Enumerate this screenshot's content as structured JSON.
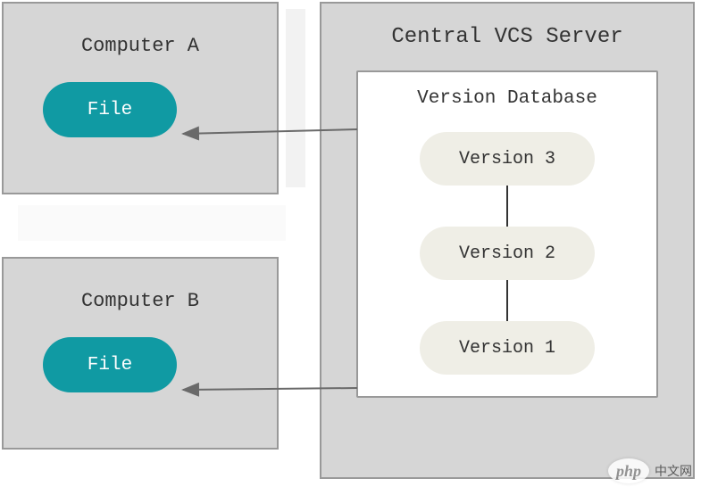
{
  "computers": {
    "a": {
      "title": "Computer A",
      "file_label": "File"
    },
    "b": {
      "title": "Computer B",
      "file_label": "File"
    }
  },
  "server": {
    "title": "Central VCS Server",
    "database": {
      "title": "Version Database",
      "versions": [
        "Version 3",
        "Version 2",
        "Version 1"
      ]
    }
  },
  "watermark": {
    "badge": "php",
    "text": "中文网"
  },
  "colors": {
    "box_bg": "#d6d6d6",
    "box_border": "#999999",
    "file_pill": "#109aa3",
    "version_pill": "#efeee6",
    "arrow": "#6a6a6a"
  }
}
